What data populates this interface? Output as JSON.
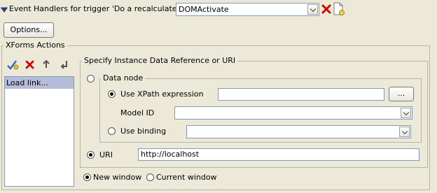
{
  "header": {
    "event_label": "Event Handlers for trigger 'Do a recalculate now'",
    "event_value": "DOMActivate",
    "options_label": "Options..."
  },
  "actions": {
    "title": "XForms Actions",
    "items": [
      "Load link..."
    ],
    "selected_index": 0
  },
  "details": {
    "title": "Specify Instance Data Reference or URI",
    "data_node_label": "Data node",
    "use_xpath_label": "Use XPath expression",
    "xpath_value": "",
    "browse_label": "...",
    "model_id_label": "Model ID",
    "model_id_value": "",
    "use_binding_label": "Use binding",
    "binding_value": "",
    "uri_label": "URI",
    "uri_value": "http://localhost",
    "data_node_mode": "xpath",
    "source": "uri"
  },
  "window": {
    "new_window_label": "New window",
    "current_window_label": "Current window",
    "selected": "new"
  },
  "colors": {
    "background": "#ece9d8",
    "selection": "#b6bddb",
    "delete_red": "#d40000"
  }
}
